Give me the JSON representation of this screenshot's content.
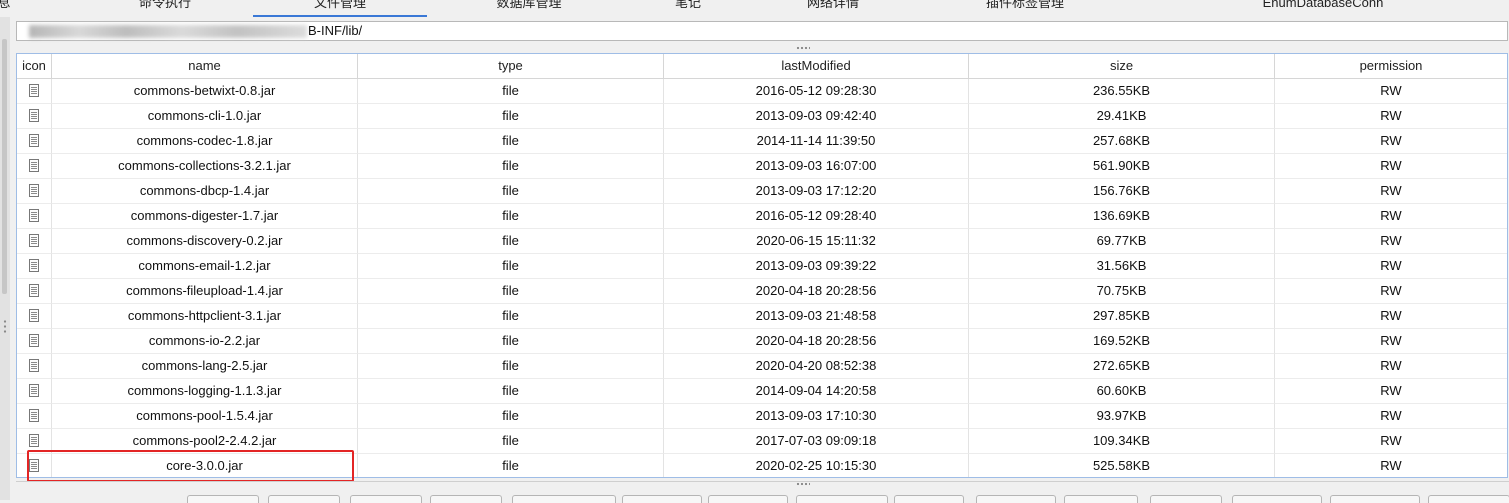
{
  "tabs": [
    {
      "label": "息",
      "active": false
    },
    {
      "label": "命令执行",
      "active": false
    },
    {
      "label": "文件管理",
      "active": true
    },
    {
      "label": "数据库管理",
      "active": false
    },
    {
      "label": "笔记",
      "active": false
    },
    {
      "label": "网络详情",
      "active": false
    },
    {
      "label": "插件标签管理",
      "active": false
    },
    {
      "label": "EnumDatabaseConn",
      "active": false
    }
  ],
  "path": {
    "value": "B-INF/lib/"
  },
  "table": {
    "columns": [
      "icon",
      "name",
      "type",
      "lastModified",
      "size",
      "permission"
    ],
    "rows": [
      {
        "icon": "file-icon",
        "name": "commons-betwixt-0.8.jar",
        "type": "file",
        "lastModified": "2016-05-12 09:28:30",
        "size": "236.55KB",
        "permission": "RW"
      },
      {
        "icon": "file-icon",
        "name": "commons-cli-1.0.jar",
        "type": "file",
        "lastModified": "2013-09-03 09:42:40",
        "size": "29.41KB",
        "permission": "RW"
      },
      {
        "icon": "file-icon",
        "name": "commons-codec-1.8.jar",
        "type": "file",
        "lastModified": "2014-11-14 11:39:50",
        "size": "257.68KB",
        "permission": "RW"
      },
      {
        "icon": "file-icon",
        "name": "commons-collections-3.2.1.jar",
        "type": "file",
        "lastModified": "2013-09-03 16:07:00",
        "size": "561.90KB",
        "permission": "RW"
      },
      {
        "icon": "file-icon",
        "name": "commons-dbcp-1.4.jar",
        "type": "file",
        "lastModified": "2013-09-03 17:12:20",
        "size": "156.76KB",
        "permission": "RW"
      },
      {
        "icon": "file-icon",
        "name": "commons-digester-1.7.jar",
        "type": "file",
        "lastModified": "2016-05-12 09:28:40",
        "size": "136.69KB",
        "permission": "RW"
      },
      {
        "icon": "file-icon",
        "name": "commons-discovery-0.2.jar",
        "type": "file",
        "lastModified": "2020-06-15 15:11:32",
        "size": "69.77KB",
        "permission": "RW"
      },
      {
        "icon": "file-icon",
        "name": "commons-email-1.2.jar",
        "type": "file",
        "lastModified": "2013-09-03 09:39:22",
        "size": "31.56KB",
        "permission": "RW"
      },
      {
        "icon": "file-icon",
        "name": "commons-fileupload-1.4.jar",
        "type": "file",
        "lastModified": "2020-04-18 20:28:56",
        "size": "70.75KB",
        "permission": "RW"
      },
      {
        "icon": "file-icon",
        "name": "commons-httpclient-3.1.jar",
        "type": "file",
        "lastModified": "2013-09-03 21:48:58",
        "size": "297.85KB",
        "permission": "RW"
      },
      {
        "icon": "file-icon",
        "name": "commons-io-2.2.jar",
        "type": "file",
        "lastModified": "2020-04-18 20:28:56",
        "size": "169.52KB",
        "permission": "RW"
      },
      {
        "icon": "file-icon",
        "name": "commons-lang-2.5.jar",
        "type": "file",
        "lastModified": "2020-04-20 08:52:38",
        "size": "272.65KB",
        "permission": "RW"
      },
      {
        "icon": "file-icon",
        "name": "commons-logging-1.1.3.jar",
        "type": "file",
        "lastModified": "2014-09-04 14:20:58",
        "size": "60.60KB",
        "permission": "RW"
      },
      {
        "icon": "file-icon",
        "name": "commons-pool-1.5.4.jar",
        "type": "file",
        "lastModified": "2013-09-03 17:10:30",
        "size": "93.97KB",
        "permission": "RW"
      },
      {
        "icon": "file-icon",
        "name": "commons-pool2-2.4.2.jar",
        "type": "file",
        "lastModified": "2017-07-03 09:09:18",
        "size": "109.34KB",
        "permission": "RW"
      },
      {
        "icon": "file-icon",
        "name": "core-3.0.0.jar",
        "type": "file",
        "lastModified": "2020-02-25 10:15:30",
        "size": "525.58KB",
        "permission": "RW",
        "highlighted": true
      }
    ]
  },
  "colors": {
    "active_tab": "#3a78d6",
    "highlight": "#e32525",
    "table_border": "#9fbde6"
  }
}
